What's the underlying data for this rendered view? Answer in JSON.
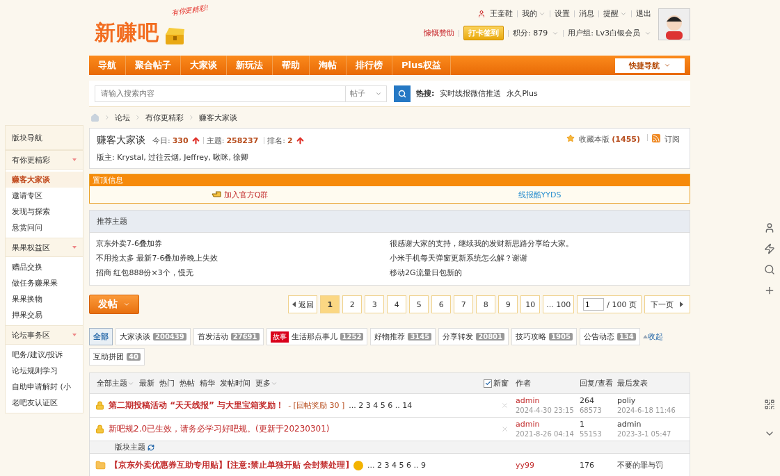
{
  "logo": {
    "text": "新赚吧",
    "slogan": "有你更精彩!"
  },
  "user_links": [
    {
      "label": "王奎鞋",
      "kind": "user",
      "dropdown": false
    },
    {
      "label": "我的",
      "kind": "link",
      "dropdown": true
    },
    {
      "label": "设置",
      "kind": "link",
      "dropdown": false
    },
    {
      "label": "消息",
      "kind": "link",
      "dropdown": false
    },
    {
      "label": "提醒",
      "kind": "link",
      "dropdown": true
    },
    {
      "label": "退出",
      "kind": "link",
      "dropdown": false
    }
  ],
  "user_info": {
    "sponsor": "慷慨赞助",
    "checkin": "打卡签到",
    "points": "积分: 879",
    "group": "用户组: Lv3白银会员"
  },
  "nav": {
    "items": [
      "导航",
      "聚合帖子",
      "大家谈",
      "新玩法",
      "帮助",
      "淘帖",
      "排行榜",
      "Plus权益"
    ],
    "quick": "快捷导航"
  },
  "search": {
    "placeholder": "请输入搜索内容",
    "scope": "帖子",
    "hot_label": "热搜:",
    "hot": [
      "实时线报微信推送",
      "永久Plus"
    ]
  },
  "breadcrumb": [
    "论坛",
    "有你更精彩",
    "赚客大家谈"
  ],
  "sidebar": {
    "title": "版块导航",
    "groups": [
      {
        "label": "有你更精彩",
        "items": [
          {
            "label": "赚客大家谈",
            "selected": true
          },
          {
            "label": "邀请专区",
            "selected": false
          },
          {
            "label": "发现与探索",
            "selected": false
          },
          {
            "label": "悬赏问问",
            "selected": false
          }
        ]
      },
      {
        "label": "果果权益区",
        "items": [
          {
            "label": "赠品交换",
            "selected": false
          },
          {
            "label": "做任务赚果果",
            "selected": false
          },
          {
            "label": "果果换物",
            "selected": false
          },
          {
            "label": "押果交易",
            "selected": false
          }
        ]
      },
      {
        "label": "论坛事务区",
        "items": [
          {
            "label": "吧务/建议/投诉",
            "selected": false
          },
          {
            "label": "论坛规则学习",
            "selected": false
          },
          {
            "label": "自助申请解封 (小",
            "selected": false
          },
          {
            "label": "老吧友认证区",
            "selected": false
          }
        ]
      }
    ]
  },
  "forum": {
    "title": "赚客大家谈",
    "stats": [
      {
        "label": "今日:",
        "value": "330",
        "arrow": true
      },
      {
        "label": "主题:",
        "value": "258237",
        "arrow": false
      },
      {
        "label": "排名:",
        "value": "2",
        "arrow": true
      }
    ],
    "moderators_label": "版主:",
    "moderators": "Krystal, 过往云烟, Jeffrey, 啾咪, 徐卿",
    "favorite": "收藏本版",
    "favorite_count": "(1455)",
    "subscribe": "订阅"
  },
  "pinned": {
    "title": "置顶信息",
    "links": [
      "加入官方Q群",
      "线报酷YYDS"
    ]
  },
  "recommended": {
    "title": "推荐主题",
    "items": [
      "京东外卖7-6叠加券",
      "很感谢大家的支持，继续我的发财新思路分享给大家。",
      "不用抢太多 最新7-6叠加券晚上失效",
      "小米手机每天弹窗更新系统怎么解？谢谢",
      "招商 红包888份×3个，慢无",
      "移动2G流量日包新的"
    ]
  },
  "post_button": "发帖",
  "pager": {
    "back": "返回",
    "pages": [
      {
        "label": "1",
        "selected": true
      },
      {
        "label": "2",
        "selected": false
      },
      {
        "label": "3",
        "selected": false
      },
      {
        "label": "4",
        "selected": false
      },
      {
        "label": "5",
        "selected": false
      },
      {
        "label": "6",
        "selected": false
      },
      {
        "label": "7",
        "selected": false
      },
      {
        "label": "8",
        "selected": false
      },
      {
        "label": "9",
        "selected": false
      },
      {
        "label": "10",
        "selected": false
      },
      {
        "label": "... 100",
        "selected": false
      }
    ],
    "page_input": "1",
    "total": "/ 100 页",
    "next": "下一页"
  },
  "categories": [
    {
      "label": "全部",
      "selected": true
    },
    {
      "label": "大家谈谈",
      "count": "200439",
      "selected": false
    },
    {
      "label": "首发活动",
      "count": "27691",
      "selected": false
    },
    {
      "label": "生活那点事儿",
      "count": "1252",
      "tag": "故事",
      "selected": false
    },
    {
      "label": "好物推荐",
      "count": "3145",
      "selected": false
    },
    {
      "label": "分享转发",
      "count": "20801",
      "selected": false
    },
    {
      "label": "技巧攻略",
      "count": "1905",
      "selected": false
    },
    {
      "label": "公告动态",
      "count": "134",
      "selected": false
    },
    {
      "label": "互助拼团",
      "count": "40",
      "selected": false
    }
  ],
  "collapse": "收起",
  "table": {
    "filters": [
      {
        "label": "全部主题",
        "dropdown": true
      },
      {
        "label": "最新",
        "dropdown": false
      },
      {
        "label": "热门",
        "dropdown": false
      },
      {
        "label": "热帖",
        "dropdown": false
      },
      {
        "label": "精华",
        "dropdown": false
      },
      {
        "label": "发帖时间",
        "dropdown": false
      },
      {
        "label": "更多",
        "dropdown": true
      }
    ],
    "new_window": {
      "label": "新窗",
      "checked": true
    },
    "columns": [
      "作者",
      "回复/查看",
      "最后发表"
    ],
    "rows": [
      {
        "kind": "sticky",
        "title": "第二期投稿活动 “天天线报” 与大里宝箱奖励！",
        "bold": true,
        "reward": "- [回帖奖励 30 ]",
        "pages": [
          "...",
          "2",
          "3",
          "4",
          "5",
          "6",
          "..",
          "14"
        ],
        "author": "admin",
        "date": "2024-4-30 23:15",
        "replies": "264",
        "views": "68573",
        "last_user": "poliy",
        "last_date": "2024-6-18 11:46"
      },
      {
        "kind": "sticky",
        "title": "新吧规2.0已生效，请务必学习好吧规。(更新于20230301)",
        "bold": false,
        "author": "admin",
        "date": "2021-8-26 04:14",
        "replies": "1",
        "views": "55153",
        "last_user": "admin",
        "last_date": "2023-3-1 05:47"
      },
      {
        "kind": "section",
        "title": "版块主题"
      },
      {
        "kind": "thread",
        "title": "【京东外卖优惠券互助专用贴】[注意:禁止单独开贴 会封禁处理]",
        "bold": true,
        "hot": true,
        "pages": [
          "...",
          "2",
          "3",
          "4",
          "5",
          "6",
          "..",
          "9"
        ],
        "author": "yy99",
        "replies": "176",
        "last_user": "不要的罪与罚"
      }
    ]
  }
}
